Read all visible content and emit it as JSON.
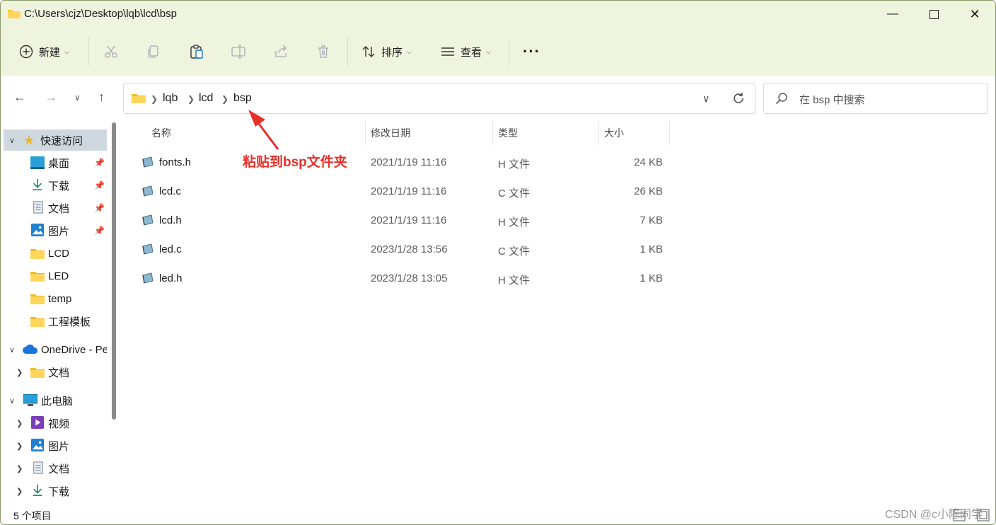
{
  "window": {
    "title": "C:\\Users\\cjz\\Desktop\\lqb\\lcd\\bsp",
    "minimize_icon": "minimize-icon",
    "maximize_icon": "maximize-icon",
    "close_icon": "close-icon"
  },
  "toolbar": {
    "new_label": "新建",
    "sort_label": "排序",
    "view_label": "查看",
    "more_label": "···"
  },
  "address": {
    "crumbs": [
      "lqb",
      "lcd",
      "bsp"
    ]
  },
  "search": {
    "placeholder": "在 bsp 中搜索"
  },
  "sidebar": {
    "quick_access": "快速访问",
    "items": [
      {
        "label": "桌面"
      },
      {
        "label": "下载"
      },
      {
        "label": "文档"
      },
      {
        "label": "图片"
      },
      {
        "label": "LCD"
      },
      {
        "label": "LED"
      },
      {
        "label": "temp"
      },
      {
        "label": "工程模板"
      }
    ],
    "onedrive": "OneDrive - Pe",
    "onedrive_items": [
      {
        "label": "文档"
      }
    ],
    "this_pc": "此电脑",
    "pc_items": [
      {
        "label": "视频"
      },
      {
        "label": "图片"
      },
      {
        "label": "文档"
      },
      {
        "label": "下载"
      }
    ]
  },
  "columns": {
    "name": "名称",
    "modified": "修改日期",
    "type": "类型",
    "size": "大小"
  },
  "files": [
    {
      "name": "fonts.h",
      "modified": "2021/1/19 11:16",
      "type": "H 文件",
      "size": "24 KB"
    },
    {
      "name": "lcd.c",
      "modified": "2021/1/19 11:16",
      "type": "C 文件",
      "size": "26 KB"
    },
    {
      "name": "lcd.h",
      "modified": "2021/1/19 11:16",
      "type": "H 文件",
      "size": "7 KB"
    },
    {
      "name": "led.c",
      "modified": "2023/1/28 13:56",
      "type": "C 文件",
      "size": "1 KB"
    },
    {
      "name": "led.h",
      "modified": "2023/1/28 13:05",
      "type": "H 文件",
      "size": "1 KB"
    }
  ],
  "annotation": "粘贴到bsp文件夹",
  "status": {
    "count": "5 个项目"
  },
  "watermark": "CSDN @c小陈同学",
  "colors": {
    "chrome": "#eef4dd",
    "annotation": "#e8302a",
    "selected": "#cfd8df"
  }
}
